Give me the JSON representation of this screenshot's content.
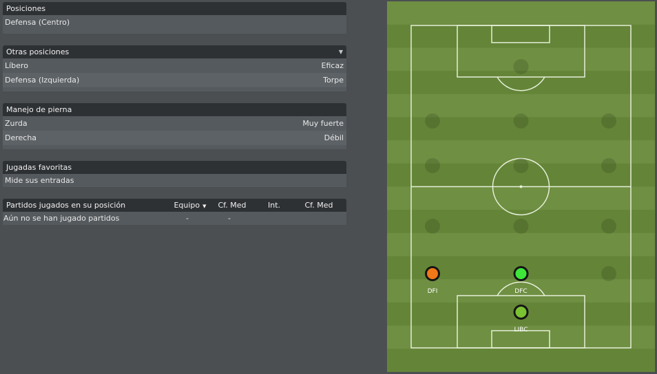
{
  "positions": {
    "header": "Posiciones",
    "value": "Defensa (Centro)"
  },
  "other_positions": {
    "header": "Otras posiciones",
    "rows": [
      {
        "label": "Líbero",
        "value": "Eficaz"
      },
      {
        "label": "Defensa (Izquierda)",
        "value": "Torpe"
      }
    ]
  },
  "foot": {
    "header": "Manejo de pierna",
    "rows": [
      {
        "label": "Zurda",
        "value": "Muy fuerte"
      },
      {
        "label": "Derecha",
        "value": "Débil"
      }
    ]
  },
  "favorites": {
    "header": "Jugadas favoritas",
    "value": "Mide sus entradas"
  },
  "matches": {
    "columns": [
      "Partidos jugados en su posición",
      "Equipo",
      "Cf. Med",
      "Int.",
      "Cf. Med"
    ],
    "row": {
      "label": "Aún no se han jugado partidos",
      "equipo": "-",
      "cfmed": "-",
      "int": "",
      "cfmed2": ""
    }
  },
  "pitch": {
    "players": [
      {
        "label": "DFI",
        "color": "#f07818"
      },
      {
        "label": "DFC",
        "color": "#3ee63a"
      },
      {
        "label": "LIBC",
        "color": "#7ac232"
      }
    ],
    "colors": {
      "grass_light": "#6f8f42",
      "grass_dark": "#648538",
      "lines": "#e6efd8"
    }
  }
}
